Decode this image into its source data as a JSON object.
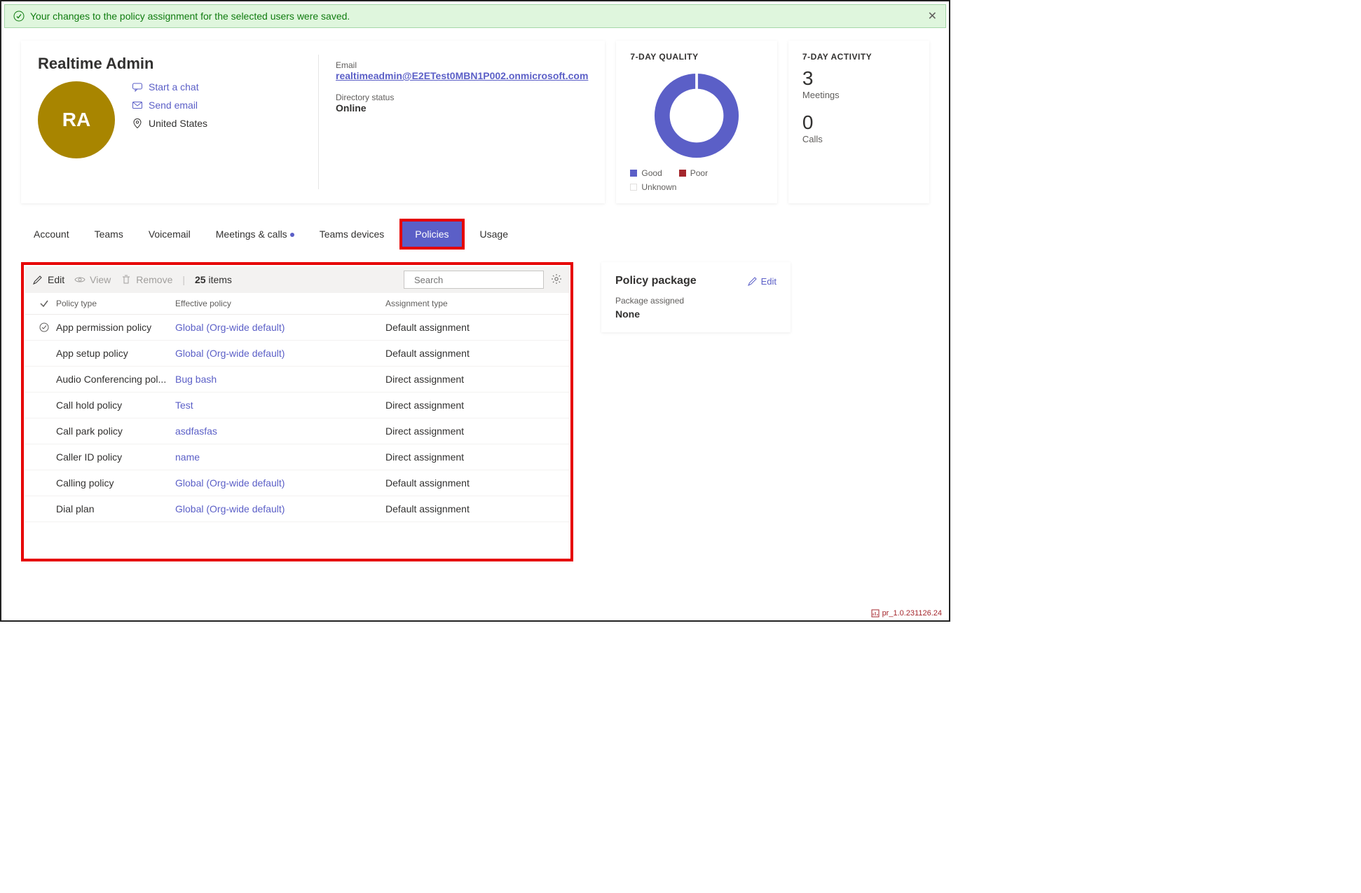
{
  "banner": {
    "text": "Your changes to the policy assignment for the selected users were saved."
  },
  "user": {
    "name": "Realtime Admin",
    "initials": "RA",
    "actions": {
      "chat": "Start a chat",
      "email": "Send email",
      "location": "United States"
    },
    "email_label": "Email",
    "email": "realtimeadmin@E2ETest0MBN1P002.onmicrosoft.com",
    "dir_label": "Directory status",
    "dir_value": "Online"
  },
  "quality": {
    "title": "7-DAY QUALITY",
    "legend": {
      "good": "Good",
      "poor": "Poor",
      "unknown": "Unknown"
    }
  },
  "activity": {
    "title": "7-DAY ACTIVITY",
    "meetings_n": "3",
    "meetings_l": "Meetings",
    "calls_n": "0",
    "calls_l": "Calls"
  },
  "tabs": {
    "account": "Account",
    "teams": "Teams",
    "voicemail": "Voicemail",
    "meetings": "Meetings & calls",
    "devices": "Teams devices",
    "policies": "Policies",
    "usage": "Usage"
  },
  "toolbar": {
    "edit": "Edit",
    "view": "View",
    "remove": "Remove",
    "items_n": "25",
    "items_l": "items",
    "search_placeholder": "Search"
  },
  "columns": {
    "type": "Policy type",
    "effective": "Effective policy",
    "assign": "Assignment type"
  },
  "rows": [
    {
      "type": "App permission policy",
      "effective": "Global (Org-wide default)",
      "assign": "Default assignment",
      "checked": true
    },
    {
      "type": "App setup policy",
      "effective": "Global (Org-wide default)",
      "assign": "Default assignment"
    },
    {
      "type": "Audio Conferencing pol...",
      "effective": "Bug bash",
      "assign": "Direct assignment"
    },
    {
      "type": "Call hold policy",
      "effective": "Test",
      "assign": "Direct assignment"
    },
    {
      "type": "Call park policy",
      "effective": "asdfasfas",
      "assign": "Direct assignment"
    },
    {
      "type": "Caller ID policy",
      "effective": "name",
      "assign": "Direct assignment"
    },
    {
      "type": "Calling policy",
      "effective": "Global (Org-wide default)",
      "assign": "Default assignment"
    },
    {
      "type": "Dial plan",
      "effective": "Global (Org-wide default)",
      "assign": "Default assignment"
    }
  ],
  "package": {
    "title": "Policy package",
    "edit": "Edit",
    "label": "Package assigned",
    "value": "None"
  },
  "footer": {
    "version": "pr_1.0.231126.24"
  },
  "colors": {
    "accent": "#5b5fc7",
    "good": "#5b5fc7",
    "poor": "#a4262c",
    "avatar": "#a88500"
  },
  "chart_data": {
    "type": "pie",
    "title": "7-DAY QUALITY",
    "series": [
      {
        "name": "Good",
        "value": 100,
        "color": "#5b5fc7"
      },
      {
        "name": "Poor",
        "value": 0,
        "color": "#a4262c"
      },
      {
        "name": "Unknown",
        "value": 0,
        "color": "#ffffff"
      }
    ]
  }
}
